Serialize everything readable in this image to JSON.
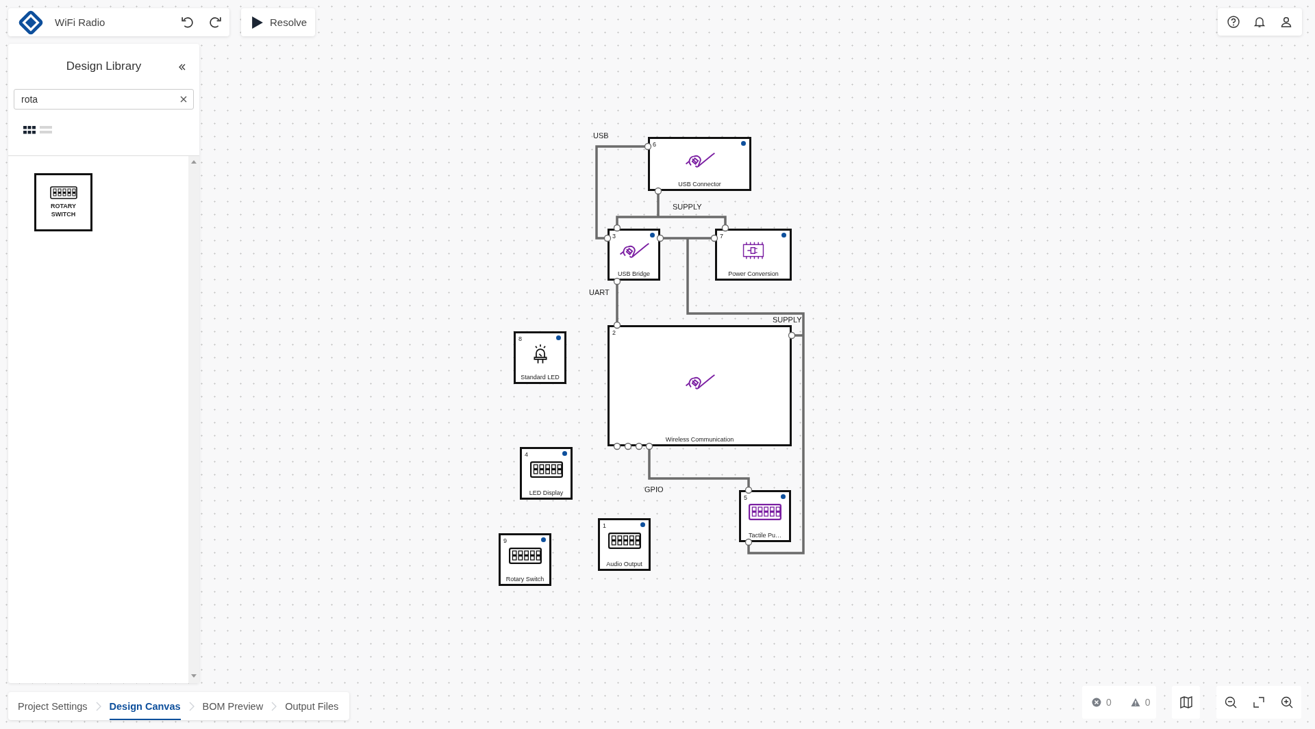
{
  "toolbar": {
    "project_name": "WiFi Radio",
    "resolve_label": "Resolve"
  },
  "library": {
    "title": "Design Library",
    "search": {
      "value": "rota"
    },
    "views": [
      {
        "kind": "grid",
        "selected": true
      },
      {
        "kind": "list",
        "selected": false
      }
    ],
    "items": [
      {
        "label": "ROTARY SWITCH"
      }
    ]
  },
  "canvas": {
    "nodes": [
      {
        "number": "6",
        "name": "USB Connector",
        "kind": "cable",
        "color": "#7b1fa2",
        "marked": true
      },
      {
        "number": "3",
        "name": "USB Bridge",
        "kind": "cable",
        "color": "#7b1fa2",
        "marked": true
      },
      {
        "number": "7",
        "name": "Power Conversion",
        "kind": "chip",
        "color": "#7b1fa2",
        "marked": true
      },
      {
        "number": "8",
        "name": "Standard LED",
        "kind": "led",
        "color": "#111111",
        "marked": true
      },
      {
        "number": "2",
        "name": "Wireless Communication",
        "kind": "cable",
        "color": "#7b1fa2",
        "marked": false
      },
      {
        "number": "4",
        "name": "LED Display",
        "kind": "switch",
        "color": "#111111",
        "marked": true
      },
      {
        "number": "5",
        "name": "Tactile Pu…",
        "kind": "switch",
        "color": "#7b1fa2",
        "marked": true
      },
      {
        "number": "1",
        "name": "Audio Output",
        "kind": "switch",
        "color": "#111111",
        "marked": true
      },
      {
        "number": "9",
        "name": "Rotary Switch",
        "kind": "switch",
        "color": "#111111",
        "marked": true
      }
    ],
    "nets": [
      {
        "label": "USB"
      },
      {
        "label": "SUPPLY"
      },
      {
        "label": "UART"
      },
      {
        "label": "SUPPLY"
      },
      {
        "label": "GPIO"
      }
    ]
  },
  "steps": [
    {
      "label": "Project Settings",
      "selected": false
    },
    {
      "label": "Design Canvas",
      "selected": true
    },
    {
      "label": "BOM Preview",
      "selected": false
    },
    {
      "label": "Output Files",
      "selected": false
    }
  ],
  "status": {
    "errors": "0",
    "warnings": "0"
  }
}
